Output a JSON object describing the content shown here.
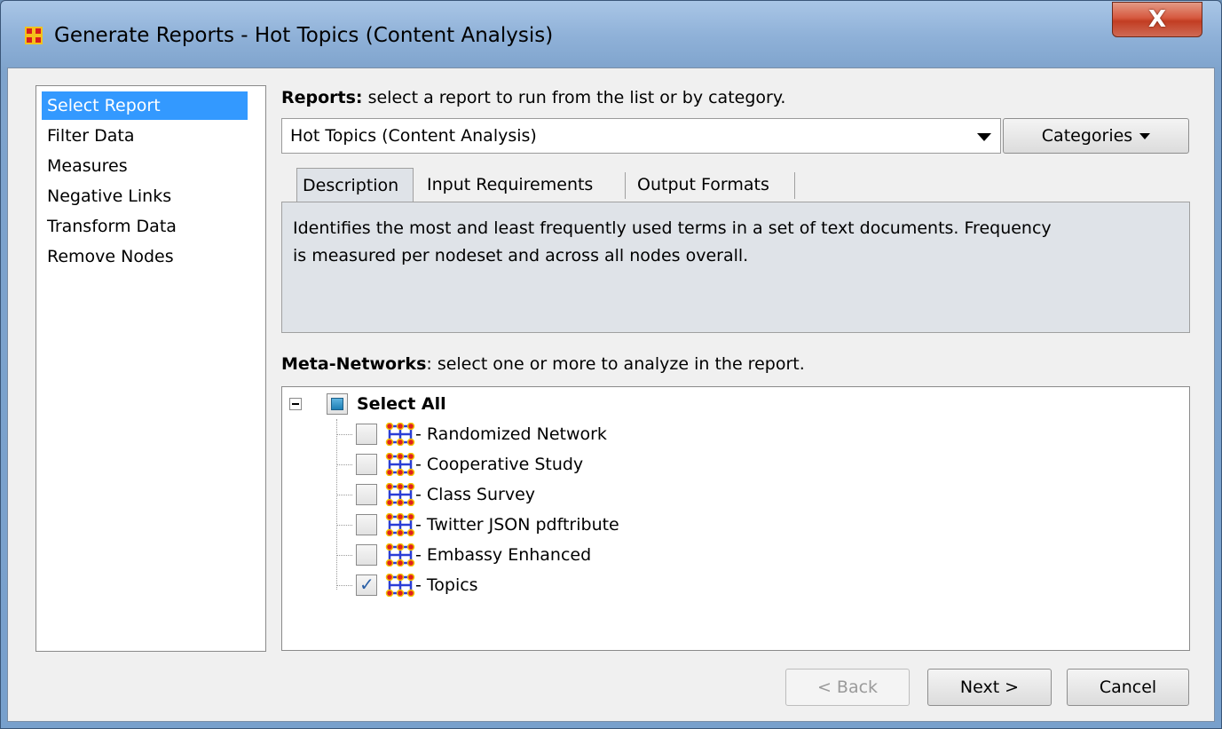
{
  "window": {
    "title": "Generate Reports - Hot Topics (Content Analysis)",
    "close_label": "X"
  },
  "sidebar": {
    "items": [
      {
        "label": "Select Report",
        "selected": true
      },
      {
        "label": "Filter Data",
        "selected": false
      },
      {
        "label": "Measures",
        "selected": false
      },
      {
        "label": "Negative Links",
        "selected": false
      },
      {
        "label": "Transform Data",
        "selected": false
      },
      {
        "label": "Remove Nodes",
        "selected": false
      }
    ]
  },
  "reports": {
    "heading": "Reports:",
    "instruction": " select a report to run from the list or by category.",
    "selected_report": "Hot Topics (Content Analysis)",
    "categories_label": "Categories"
  },
  "tabs": [
    {
      "label": "Description",
      "active": true
    },
    {
      "label": "Input Requirements",
      "active": false
    },
    {
      "label": "Output Formats",
      "active": false
    }
  ],
  "description": {
    "line1": "Identifies the most and least frequently used terms in a set of text documents. Frequency",
    "line2": "is measured per nodeset and across all nodes overall."
  },
  "meta_networks": {
    "heading": "Meta-Networks",
    "instruction": ": select one or more to analyze in the report.",
    "select_all_label": "Select All",
    "items": [
      {
        "label": "- Randomized Network",
        "checked": false
      },
      {
        "label": "- Cooperative Study",
        "checked": false
      },
      {
        "label": "- Class Survey",
        "checked": false
      },
      {
        "label": "- Twitter JSON pdftribute",
        "checked": false
      },
      {
        "label": "- Embassy Enhanced",
        "checked": false
      },
      {
        "label": "- Topics",
        "checked": true
      }
    ]
  },
  "footer": {
    "back_label": "< Back",
    "next_label": "Next >",
    "cancel_label": "Cancel"
  },
  "colors": {
    "selection": "#3399ff",
    "icon_node_red": "#e02020",
    "icon_node_yellow": "#f2c200",
    "icon_edge_blue": "#2b3ed6"
  }
}
